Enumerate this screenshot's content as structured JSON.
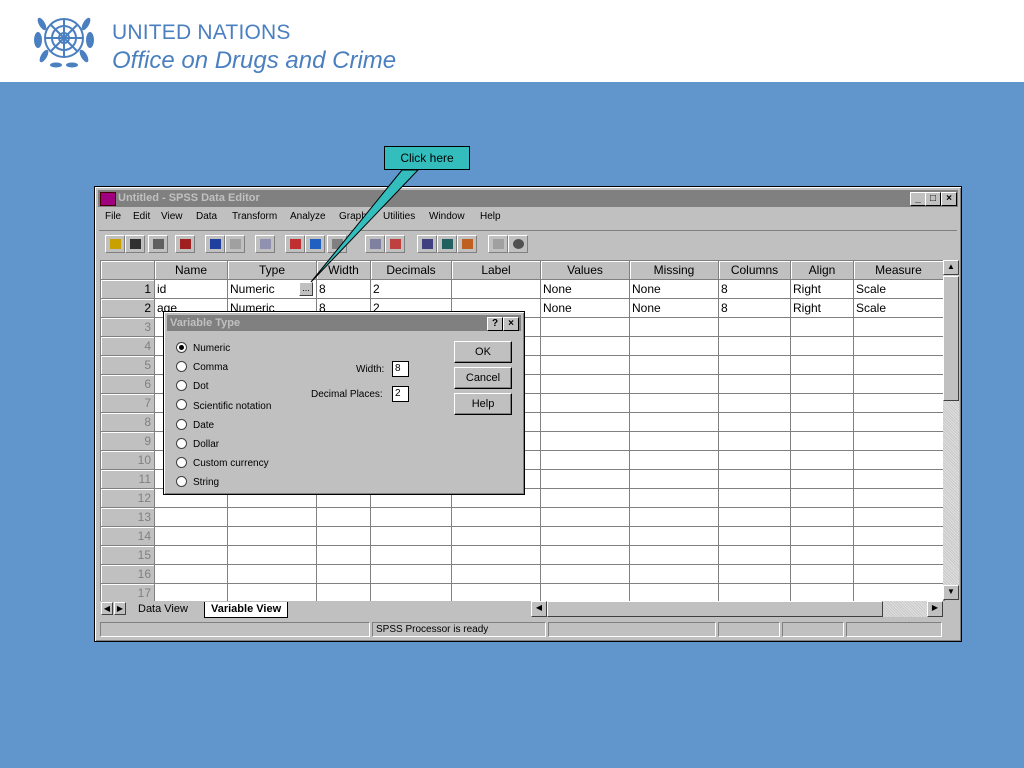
{
  "org": {
    "line1": "UNITED NATIONS",
    "line2": "Office on Drugs and Crime"
  },
  "callout": "Click here",
  "window": {
    "title": "Untitled - SPSS Data Editor",
    "controls": [
      "_",
      "□",
      "×"
    ]
  },
  "menu": [
    "File",
    "Edit",
    "View",
    "Data",
    "Transform",
    "Analyze",
    "Graphs",
    "Utilities",
    "Window",
    "Help"
  ],
  "grid": {
    "headers": [
      "Name",
      "Type",
      "Width",
      "Decimals",
      "Label",
      "Values",
      "Missing",
      "Columns",
      "Align",
      "Measure"
    ],
    "rows": [
      {
        "num": "1",
        "name": "id",
        "type": "Numeric",
        "width": "8",
        "decimals": "2",
        "label": "",
        "values": "None",
        "missing": "None",
        "columns": "8",
        "align": "Right",
        "measure": "Scale"
      },
      {
        "num": "2",
        "name": "age",
        "type": "Numeric",
        "width": "8",
        "decimals": "2",
        "label": "",
        "values": "None",
        "missing": "None",
        "columns": "8",
        "align": "Right",
        "measure": "Scale"
      }
    ],
    "empty_rows": [
      "3",
      "4",
      "5",
      "6",
      "7",
      "8",
      "9",
      "10",
      "11",
      "12",
      "13",
      "14",
      "15",
      "16",
      "17"
    ]
  },
  "tabs": {
    "data_view": "Data View",
    "variable_view": "Variable View"
  },
  "status": "SPSS Processor  is ready",
  "dialog": {
    "title": "Variable Type",
    "help_glyph": "?",
    "close_glyph": "×",
    "options": [
      "Numeric",
      "Comma",
      "Dot",
      "Scientific notation",
      "Date",
      "Dollar",
      "Custom currency",
      "String"
    ],
    "selected": "Numeric",
    "width_label": "Width:",
    "width_value": "8",
    "decimals_label": "Decimal Places:",
    "decimals_value": "2",
    "ok": "OK",
    "cancel": "Cancel",
    "help": "Help"
  },
  "colors": {
    "background": "#6096cc",
    "brand": "#4a7fc0",
    "callout": "#33bdbd",
    "window_face": "#c0c0c0"
  }
}
